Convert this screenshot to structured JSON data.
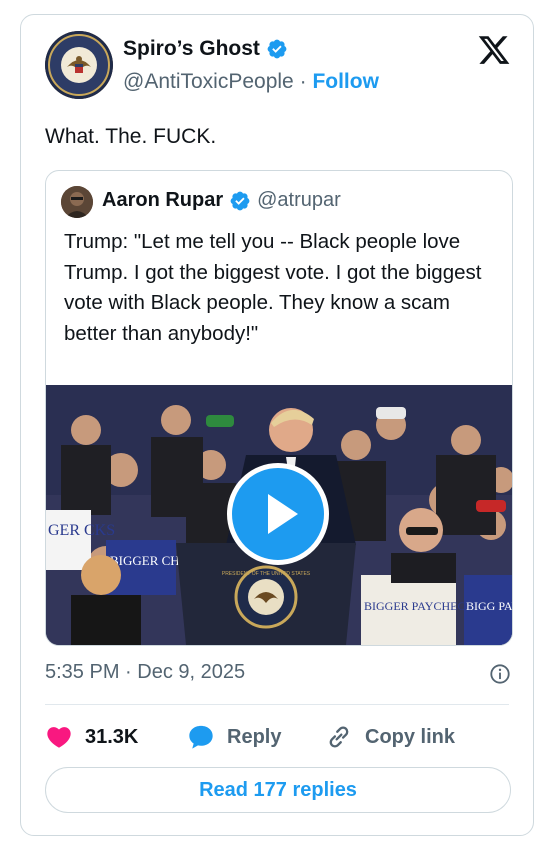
{
  "author": {
    "name": "Spiro’s Ghost",
    "handle": "@AntiToxicPeople",
    "separator": "·",
    "follow_label": "Follow",
    "seal_text": "VICE PRESIDENT OF THE UNITED STATES"
  },
  "tweet": {
    "text": "What. The. FUCK."
  },
  "quote": {
    "name": "Aaron Rupar",
    "handle": "@atrupar",
    "text": "Trump: \"Let me tell you -- Black people love Trump. I got the biggest vote. I got the biggest vote with Black people. They know a scam better than anybody!\"",
    "video": {
      "signs": [
        "BIGGER PAYCHECKS",
        "BIGGER CHECKS",
        "GER CKS",
        "BIGG PAYCH"
      ],
      "podium_seal_text": "PRESIDENT OF THE UNITED STATES"
    }
  },
  "meta": {
    "timestamp": "5:35 PM · Dec 9, 2025"
  },
  "actions": {
    "likes": "31.3K",
    "reply_label": "Reply",
    "copy_label": "Copy link",
    "read_replies": "Read 177 replies"
  },
  "icons": {
    "verified": "verified-badge-icon",
    "x_logo": "x-logo-icon",
    "like": "heart-icon",
    "reply": "reply-bubble-icon",
    "copy": "link-icon",
    "info": "info-icon",
    "play": "play-icon"
  },
  "colors": {
    "accent": "#1d9bf0",
    "like": "#f91880",
    "text": "#0f1419",
    "muted": "#536471",
    "border": "#cfd9de"
  }
}
